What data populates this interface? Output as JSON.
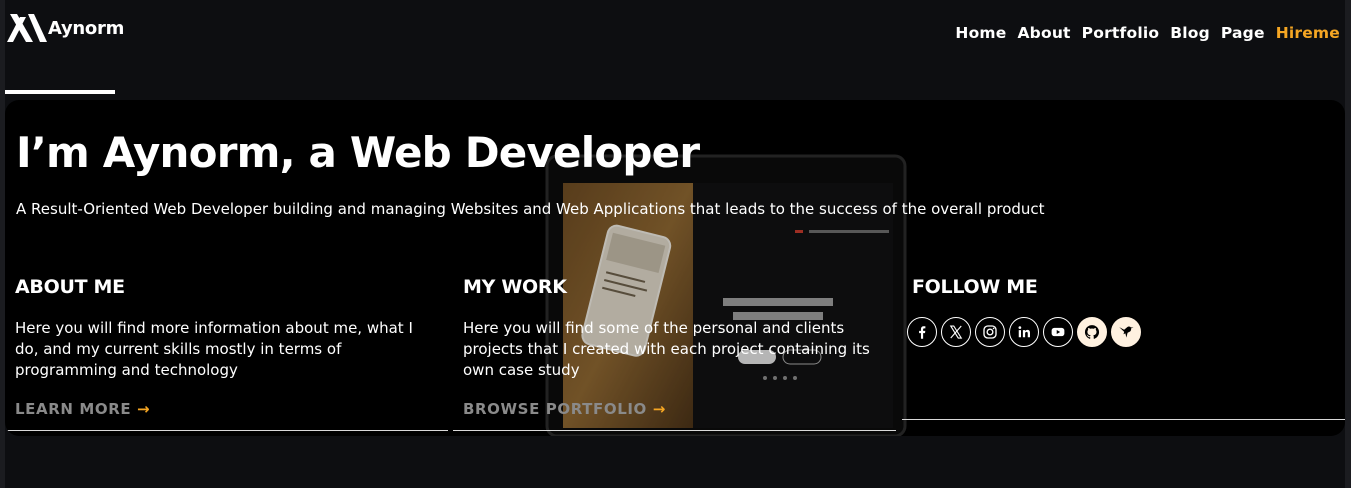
{
  "brand": {
    "name": "Aynorm"
  },
  "nav": {
    "home": "Home",
    "about": "About",
    "portfolio": "Portfolio",
    "blog": "Blog",
    "page": "Page",
    "hireme": "Hireme"
  },
  "hero": {
    "title": "I’m Aynorm, a Web Developer",
    "subtitle": "A Result-Oriented Web Developer building and managing Websites and Web Applications that leads to the success of the overall product"
  },
  "columns": {
    "about": {
      "heading": "ABOUT ME",
      "text": "Here you will find more information about me, what I do, and my current skills mostly in terms of programming and technology",
      "cta": "LEARN MORE",
      "arrow": "→"
    },
    "work": {
      "heading": "MY WORK",
      "text": "Here you will find some of the personal and clients projects that I created with each project containing its own case study",
      "cta": "BROWSE PORTFOLIO",
      "arrow": "→"
    },
    "follow": {
      "heading": "FOLLOW ME"
    }
  },
  "social_icons": [
    "facebook-icon",
    "x-twitter-icon",
    "instagram-icon",
    "linkedin-icon",
    "youtube-icon",
    "github-icon",
    "hummingbird-icon"
  ],
  "colors": {
    "accent": "#f5a623",
    "background": "#0d0e11",
    "hero_background": "#000000",
    "text": "#ffffff",
    "muted": "#8a8a8a"
  }
}
